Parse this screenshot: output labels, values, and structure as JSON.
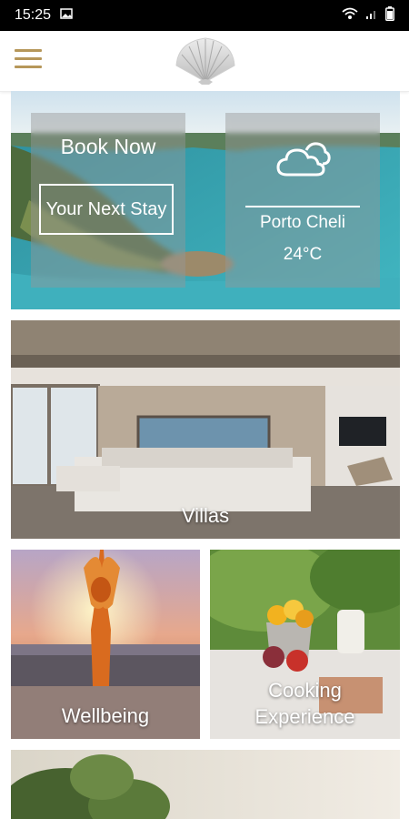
{
  "status_bar": {
    "time": "15:25"
  },
  "hero": {
    "book_title": "Book Now",
    "book_button": "Your Next Stay",
    "weather_icon": "cloud-icon",
    "city": "Porto Cheli",
    "temperature": "24°C"
  },
  "tiles": {
    "villas": "Villas",
    "wellbeing": "Wellbeing",
    "cooking_line1": "Cooking",
    "cooking_line2": "Experience"
  },
  "colors": {
    "accent": "#b6975a",
    "statusbar": "#000000"
  }
}
